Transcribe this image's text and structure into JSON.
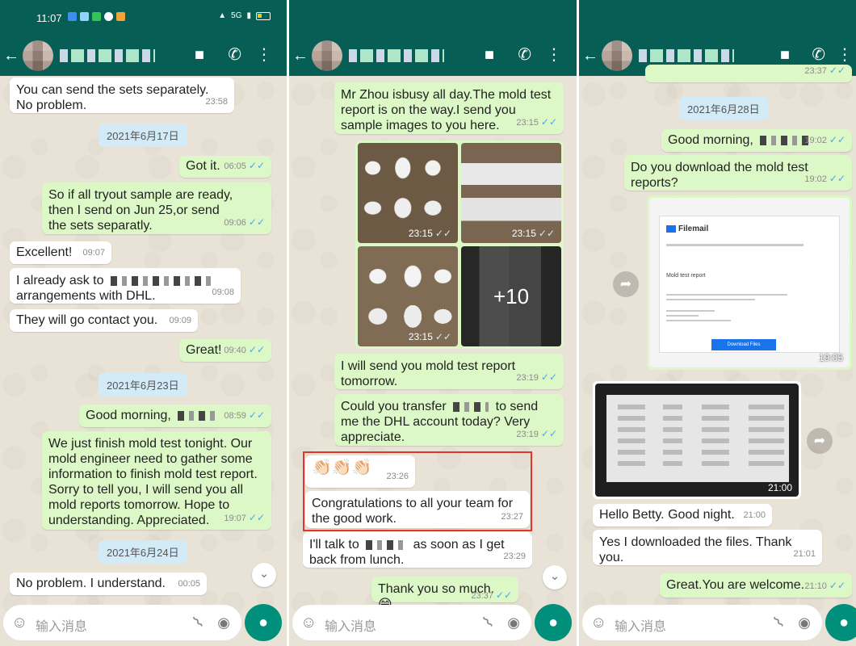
{
  "status_bar": {
    "time": "11:07",
    "network": "5G"
  },
  "composer": {
    "placeholder": "输入消息"
  },
  "panel1": {
    "messages": [
      {
        "text": "You can send the sets separately. No problem.",
        "time": "23:58"
      },
      {
        "date": "2021年6月17日"
      },
      {
        "text": "Got it.",
        "time": "06:05"
      },
      {
        "text": "So if all tryout sample are ready, then I send on Jun 25,or send the sets separatly.",
        "time": "09:06"
      },
      {
        "text": "Excellent!",
        "time": "09:07"
      },
      {
        "text_a": "I already ask to",
        "text_b": "arrangements with DHL.",
        "time": "09:08"
      },
      {
        "text": "They will go contact you.",
        "time": "09:09"
      },
      {
        "text": "Great!",
        "time": "09:40"
      },
      {
        "date": "2021年6月23日"
      },
      {
        "text": "Good morning,",
        "time": "08:59"
      },
      {
        "text": "We just finish mold test tonight. Our mold engineer need to gather some information to finish mold test report. Sorry to tell you, I will send you all mold reports tomorrow. Hope to understanding. Appreciated.",
        "time": "19:07"
      },
      {
        "date": "2021年6月24日"
      },
      {
        "text": "No problem. I understand.",
        "time": "00:05"
      }
    ]
  },
  "panel2": {
    "messages": [
      {
        "text": "Mr Zhou isbusy all day.The mold test report is on the way.I send you sample images to you here.",
        "time": "23:15"
      },
      {
        "photos": [
          "23:15",
          "23:15",
          "23:15"
        ],
        "more_count": "+10"
      },
      {
        "text": "I will send you mold test report tomorrow.",
        "time": "23:19"
      },
      {
        "text_a": "Could you transfer",
        "text_b": "to send me the DHL account today? Very appreciate.",
        "time": "23:19"
      },
      {
        "emoji": "👏🏻👏🏻👏🏻",
        "time": "23:26"
      },
      {
        "text": "Congratulations to all your team for the good work.",
        "time": "23:27"
      },
      {
        "text_a": "I'll talk to",
        "text_b": "as soon as I get back from lunch.",
        "time": "23:29"
      },
      {
        "text": "Thank you so much.",
        "emoji": "😄",
        "time": "23:37"
      }
    ]
  },
  "panel3": {
    "messages": [
      {
        "time": "23:37"
      },
      {
        "date": "2021年6月28日"
      },
      {
        "text": "Good morning,",
        "time": "19:02"
      },
      {
        "text": "Do you download the mold test reports?",
        "time": "19:02"
      },
      {
        "doc": {
          "brand": "Filemail",
          "title": "Mold test report",
          "button": "Download Files"
        },
        "time": "19:05"
      },
      {
        "photo_time": "21:00"
      },
      {
        "text": "Hello Betty. Good night.",
        "time": "21:00"
      },
      {
        "text": "Yes I downloaded the files. Thank you.",
        "time": "21:01"
      },
      {
        "text": "Great.You are welcome.",
        "time": "21:10"
      }
    ]
  },
  "icons": {
    "back": "arrow-left-icon",
    "video": "video-call-icon",
    "phone": "voice-call-icon",
    "menu": "more-vertical-icon",
    "emoji": "emoji-icon",
    "attach": "paperclip-icon",
    "camera": "camera-icon",
    "mic": "microphone-icon",
    "read_ticks": "double-check-icon",
    "forward": "forward-icon",
    "scroll": "chevron-down-icon"
  },
  "colors": {
    "header": "#075e54",
    "outgoing": "#dcf8c6",
    "incoming": "#ffffff",
    "tick": "#4fa6e8",
    "highlight": "#e0362c",
    "mic": "#008f7a"
  }
}
